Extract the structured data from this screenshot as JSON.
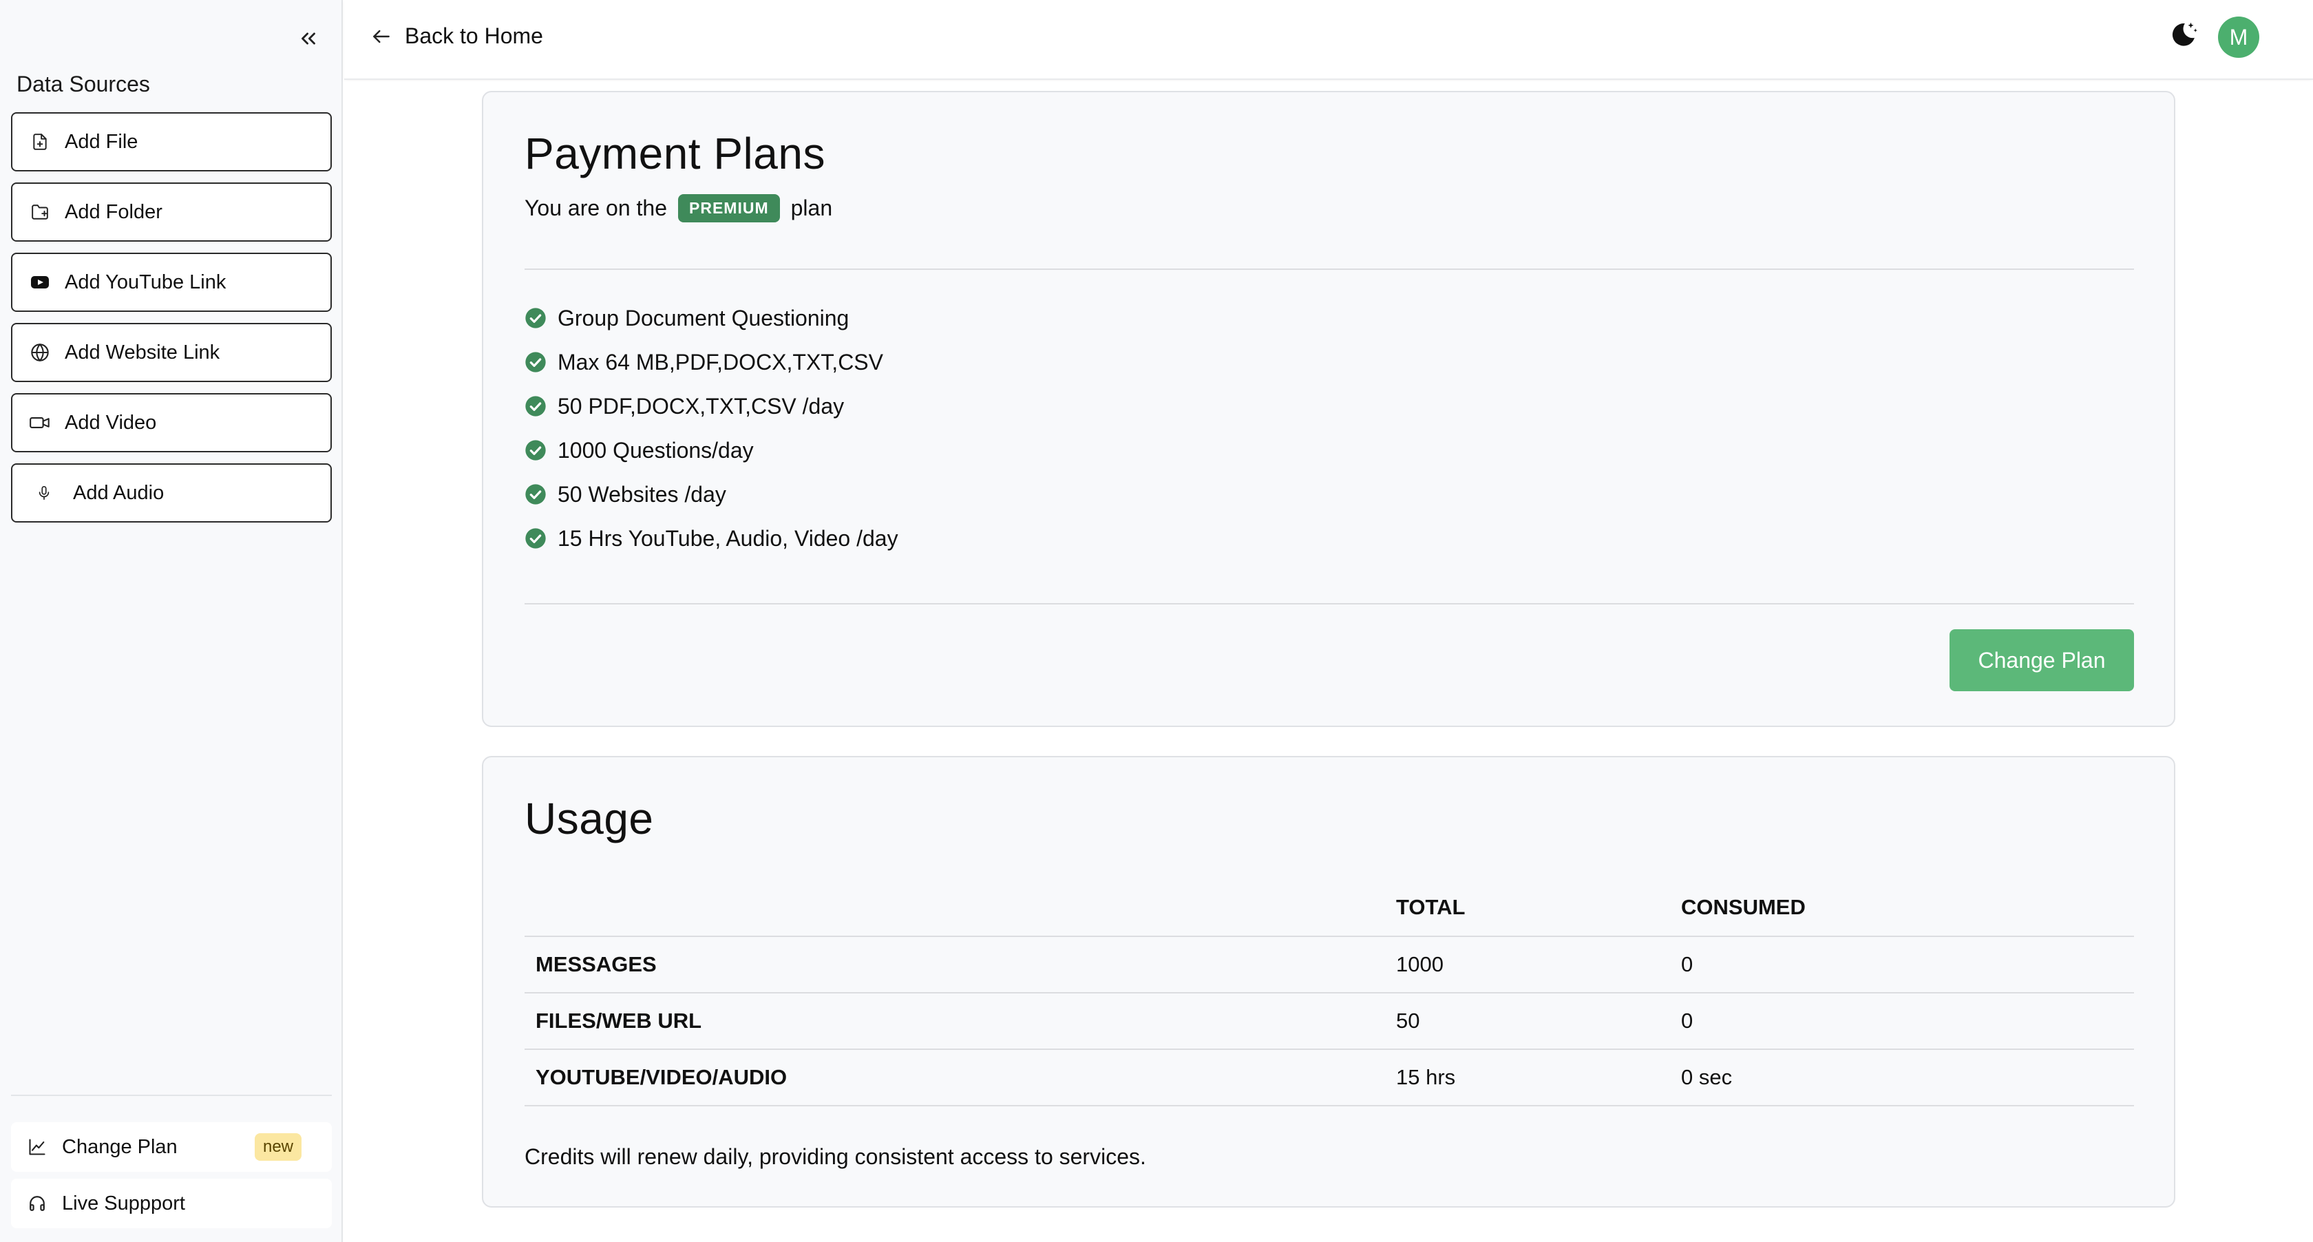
{
  "sidebar": {
    "title": "Data Sources",
    "sources": [
      {
        "label": "Add File",
        "icon": "file-plus-icon"
      },
      {
        "label": "Add Folder",
        "icon": "folder-plus-icon"
      },
      {
        "label": "Add YouTube Link",
        "icon": "youtube-icon"
      },
      {
        "label": "Add Website Link",
        "icon": "globe-icon"
      },
      {
        "label": "Add Video",
        "icon": "video-icon"
      },
      {
        "label": "Add Audio",
        "icon": "microphone-icon"
      }
    ],
    "bottom": {
      "change_plan": {
        "label": "Change Plan",
        "badge": "new",
        "icon": "chart-line-icon"
      },
      "live_support": {
        "label": "Live Suppport",
        "icon": "headphones-icon"
      }
    }
  },
  "header": {
    "back_label": "Back to Home",
    "avatar_initial": "M"
  },
  "plans": {
    "title": "Payment Plans",
    "prefix": "You are on the",
    "plan_name": "PREMIUM",
    "suffix": "plan",
    "features": [
      "Group Document Questioning",
      "Max 64 MB,PDF,DOCX,TXT,CSV",
      "50 PDF,DOCX,TXT,CSV /day",
      "1000 Questions/day",
      "50 Websites /day",
      "15 Hrs YouTube, Audio, Video /day"
    ],
    "change_plan_label": "Change Plan"
  },
  "usage": {
    "title": "Usage",
    "columns": [
      "",
      "TOTAL",
      "CONSUMED"
    ],
    "rows": [
      {
        "label": "MESSAGES",
        "total": "1000",
        "consumed": "0"
      },
      {
        "label": "FILES/WEB URL",
        "total": "50",
        "consumed": "0"
      },
      {
        "label": "YOUTUBE/VIDEO/AUDIO",
        "total": "15 hrs",
        "consumed": "0 sec"
      }
    ],
    "footnote": "Credits will renew daily, providing consistent access to services."
  },
  "colors": {
    "accent_green": "#5cb879",
    "badge_green": "#3f8a5a",
    "avatar_green": "#4caf6e",
    "new_badge_bg": "#fbe7a1"
  }
}
